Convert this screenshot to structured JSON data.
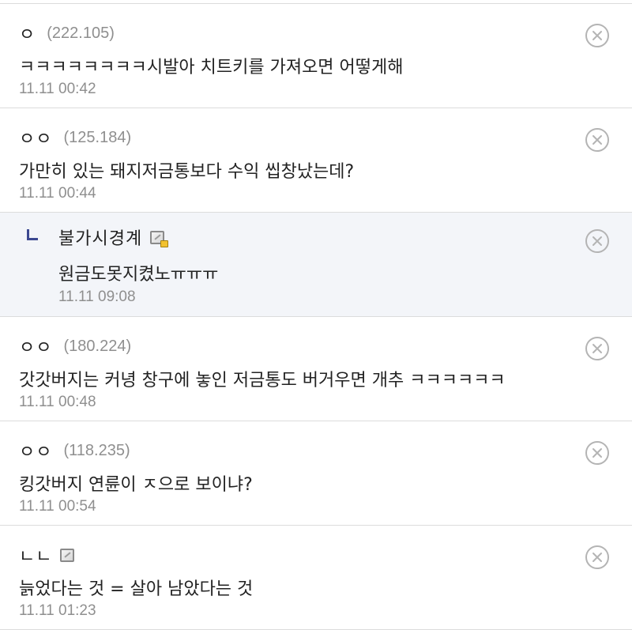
{
  "comments": [
    {
      "nick": "ㅇ",
      "ip": "(222.105)",
      "text": "ㅋㅋㅋㅋㅋㅋㅋㅋ시발아 치트키를 가져오면 어떻게해",
      "time": "11.11 00:42"
    },
    {
      "nick": "ㅇㅇ",
      "ip": "(125.184)",
      "text": "가만히 있는 돼지저금통보다 수익 씹창났는데?",
      "time": "11.11 00:44"
    },
    {
      "nick": "불가시경계",
      "text": "원금도못지켰노ㅠㅠㅠ",
      "time": "11.11 09:08",
      "badge_icon": "fixed-nick-icon"
    },
    {
      "nick": "ㅇㅇ",
      "ip": "(180.224)",
      "text": "갓갓버지는 커녕 창구에 놓인 저금통도 버거우면 개추 ㅋㅋㅋㅋㅋㅋ",
      "time": "11.11 00:48"
    },
    {
      "nick": "ㅇㅇ",
      "ip": "(118.235)",
      "text": "킹갓버지 연륜이 ㅈ으로 보이냐?",
      "time": "11.11 00:54"
    },
    {
      "nick": "ㄴㄴ",
      "text": "늙었다는 것 = 살아 남았다는 것",
      "time": "11.11 01:23",
      "badge_icon": "semi-fixed-nick-icon"
    }
  ],
  "icons": {
    "delete": "close-circle-icon",
    "reply": "reply-arrow-icon"
  },
  "colors": {
    "reply_background": "#f3f5f9",
    "reply_marker": "#3b4890",
    "meta_text": "#8f8f8f"
  }
}
